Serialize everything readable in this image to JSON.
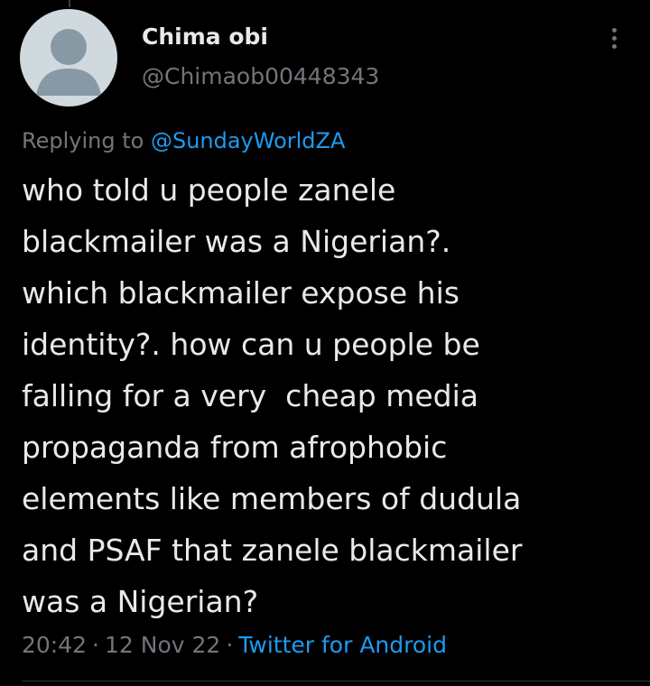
{
  "tweet": {
    "author": {
      "display_name": "Chima obi",
      "handle": "@Chimaob00448343",
      "avatar_icon": "default-profile-icon"
    },
    "reply_context": {
      "prefix": "Replying to",
      "mention": "@SundayWorldZA"
    },
    "text": "who told u people zanele\nblackmailer was a Nigerian?.\nwhich blackmailer expose his\nidentity?. how can u people be\nfalling for a very  cheap media\npropaganda from afrophobic\nelements like members of dudula\nand PSAF that zanele blackmailer\nwas a Nigerian?",
    "time": "20:42",
    "date": "12 Nov 22",
    "source": "Twitter for Android",
    "separator": "·",
    "more_icon": "more-vertical-icon"
  },
  "colors": {
    "background": "#000000",
    "text_primary": "#e7e9ea",
    "text_secondary": "#71767b",
    "accent": "#1d9bf0",
    "avatar_bg": "#cfd9de",
    "avatar_fg": "#8899a6"
  }
}
